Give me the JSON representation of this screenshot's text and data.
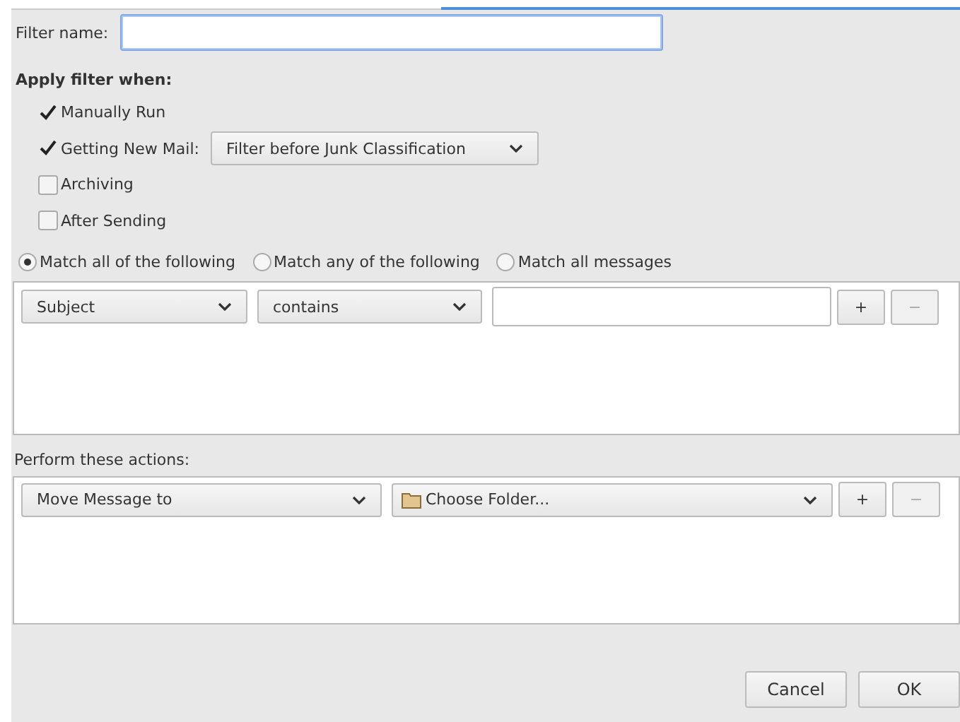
{
  "filter_name": {
    "label": "Filter name:"
  },
  "apply_when": {
    "heading": "Apply filter when:",
    "options": [
      {
        "label": "Manually Run",
        "checked": true
      },
      {
        "label": "Getting New Mail:",
        "checked": true,
        "dropdown": "Filter before Junk Classification"
      },
      {
        "label": "Archiving",
        "checked": false
      },
      {
        "label": "After Sending",
        "checked": false
      }
    ]
  },
  "match_mode": [
    {
      "label": "Match all of the following",
      "selected": true
    },
    {
      "label": "Match any of the following",
      "selected": false
    },
    {
      "label": "Match all messages",
      "selected": false
    }
  ],
  "rules": [
    {
      "field": "Subject",
      "operator": "contains",
      "add": "+",
      "remove": "−",
      "remove_disabled": true
    }
  ],
  "actions": {
    "heading": "Perform these actions:",
    "rows": [
      {
        "action": "Move Message to",
        "target": "Choose Folder...",
        "add": "+",
        "remove": "−",
        "remove_disabled": true
      }
    ]
  },
  "buttons": [
    "Cancel",
    "OK"
  ]
}
